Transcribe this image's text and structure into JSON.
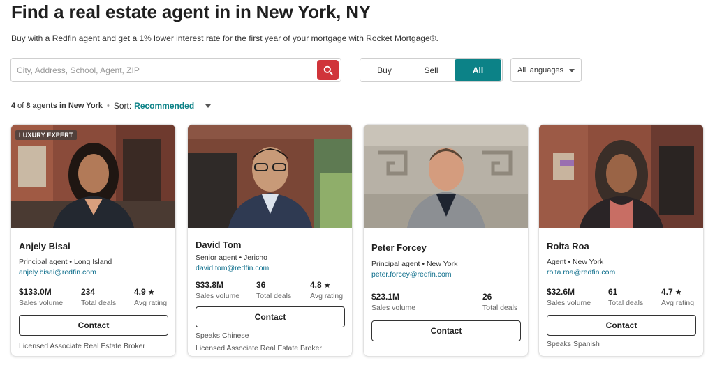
{
  "header": {
    "title": "Find a real estate agent in in New York, NY",
    "subtitle": "Buy with a Redfin agent and get a 1% lower interest rate for the first year of your mortgage with Rocket Mortgage®."
  },
  "search": {
    "placeholder": "City, Address, School, Agent, ZIP",
    "value": "",
    "button_icon": "search-icon",
    "button_color": "#d0343a"
  },
  "filter": {
    "options": [
      "Buy",
      "Sell",
      "All"
    ],
    "selected": "All",
    "accent": "#0c8287"
  },
  "language": {
    "selected": "All languages"
  },
  "results": {
    "shown": "4",
    "of_word": "of",
    "total": "8 agents in New York",
    "sort_label": "Sort:",
    "sort_value": "Recommended"
  },
  "agents": [
    {
      "badge": "LUXURY EXPERT",
      "name": "Anjely Bisai",
      "role": "Principal agent • Long Island",
      "email": "anjely.bisai@redfin.com",
      "sales_volume": "$133.0M",
      "sales_volume_label": "Sales volume",
      "total_deals": "234",
      "total_deals_label": "Total deals",
      "rating": "4.9",
      "rating_label": "Avg rating",
      "contact_label": "Contact",
      "notes": [
        "Licensed Associate Real Estate Broker"
      ]
    },
    {
      "badge": "",
      "name": "David Tom",
      "role": "Senior agent • Jericho",
      "email": "david.tom@redfin.com",
      "sales_volume": "$33.8M",
      "sales_volume_label": "Sales volume",
      "total_deals": "36",
      "total_deals_label": "Total deals",
      "rating": "4.8",
      "rating_label": "Avg rating",
      "contact_label": "Contact",
      "notes": [
        "Speaks Chinese",
        "Licensed Associate Real Estate Broker"
      ]
    },
    {
      "badge": "",
      "name": "Peter Forcey",
      "role": "Principal agent • New York",
      "email": "peter.forcey@redfin.com",
      "sales_volume": "$23.1M",
      "sales_volume_label": "Sales volume",
      "total_deals": "26",
      "total_deals_label": "Total deals",
      "rating": "",
      "rating_label": "",
      "contact_label": "Contact",
      "notes": []
    },
    {
      "badge": "",
      "name": "Roita Roa",
      "role": "Agent • New York",
      "email": "roita.roa@redfin.com",
      "sales_volume": "$32.6M",
      "sales_volume_label": "Sales volume",
      "total_deals": "61",
      "total_deals_label": "Total deals",
      "rating": "4.7",
      "rating_label": "Avg rating",
      "contact_label": "Contact",
      "notes": [
        "Speaks Spanish"
      ]
    }
  ],
  "star_icon": "star-icon"
}
